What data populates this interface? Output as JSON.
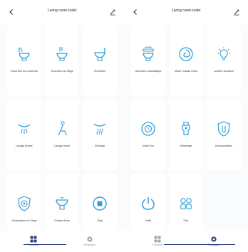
{
  "colors": {
    "accent": "#2e9fd8",
    "tab_active": "#2d3f80",
    "tab_inactive": "#a0a6b5"
  },
  "screens": [
    {
      "header": {
        "back_icon": "chevron-left-icon",
        "title": "Living room toilet",
        "edit_icon": "pencil-icon"
      },
      "tiles": [
        {
          "label": "Ouverture du Couvercle",
          "icon": "toilet-lid-open-icon"
        },
        {
          "label": "Ouverture du Siège",
          "icon": "toilet-seat-open-icon"
        },
        {
          "label": "Fermeture",
          "icon": "toilet-close-icon"
        },
        {
          "label": "Lavage Arrière",
          "icon": "rear-wash-icon"
        },
        {
          "label": "Lavage Avant",
          "icon": "front-wash-icon"
        },
        {
          "label": "Séchage",
          "icon": "dryer-icon"
        },
        {
          "label": "Température du Siège",
          "icon": "seat-temperature-icon"
        },
        {
          "label": "Chasse d'eau",
          "icon": "flush-icon"
        },
        {
          "label": "Stop",
          "icon": "stop-icon"
        }
      ],
      "tabs": [
        {
          "label": "Fonction",
          "icon": "function-grid-icon",
          "active": true
        },
        {
          "label": "Réglages",
          "icon": "settings-gear-icon",
          "active": false
        }
      ]
    },
    {
      "header": {
        "back_icon": "chevron-left-icon",
        "title": "Living room toilet",
        "edit_icon": "pencil-icon"
      },
      "tiles": [
        {
          "label": "Ouverture Automatique",
          "icon": "auto-open-icon"
        },
        {
          "label": "Mode Chasse d'eau",
          "icon": "flush-mode-icon"
        },
        {
          "label": "Lumière Nocturne",
          "icon": "night-light-icon"
        },
        {
          "label": "Mode Eco",
          "icon": "eco-mode-icon"
        },
        {
          "label": "Détartrage",
          "icon": "descaling-icon"
        },
        {
          "label": "Désodorisation",
          "icon": "deodorization-icon"
        },
        {
          "label": "Veille",
          "icon": "power-icon"
        },
        {
          "label": "Plus",
          "icon": "more-icon"
        }
      ],
      "tabs": [
        {
          "label": "Fonction",
          "icon": "function-grid-icon",
          "active": false
        },
        {
          "label": "Réglages",
          "icon": "settings-gear-icon",
          "active": true
        }
      ]
    }
  ]
}
